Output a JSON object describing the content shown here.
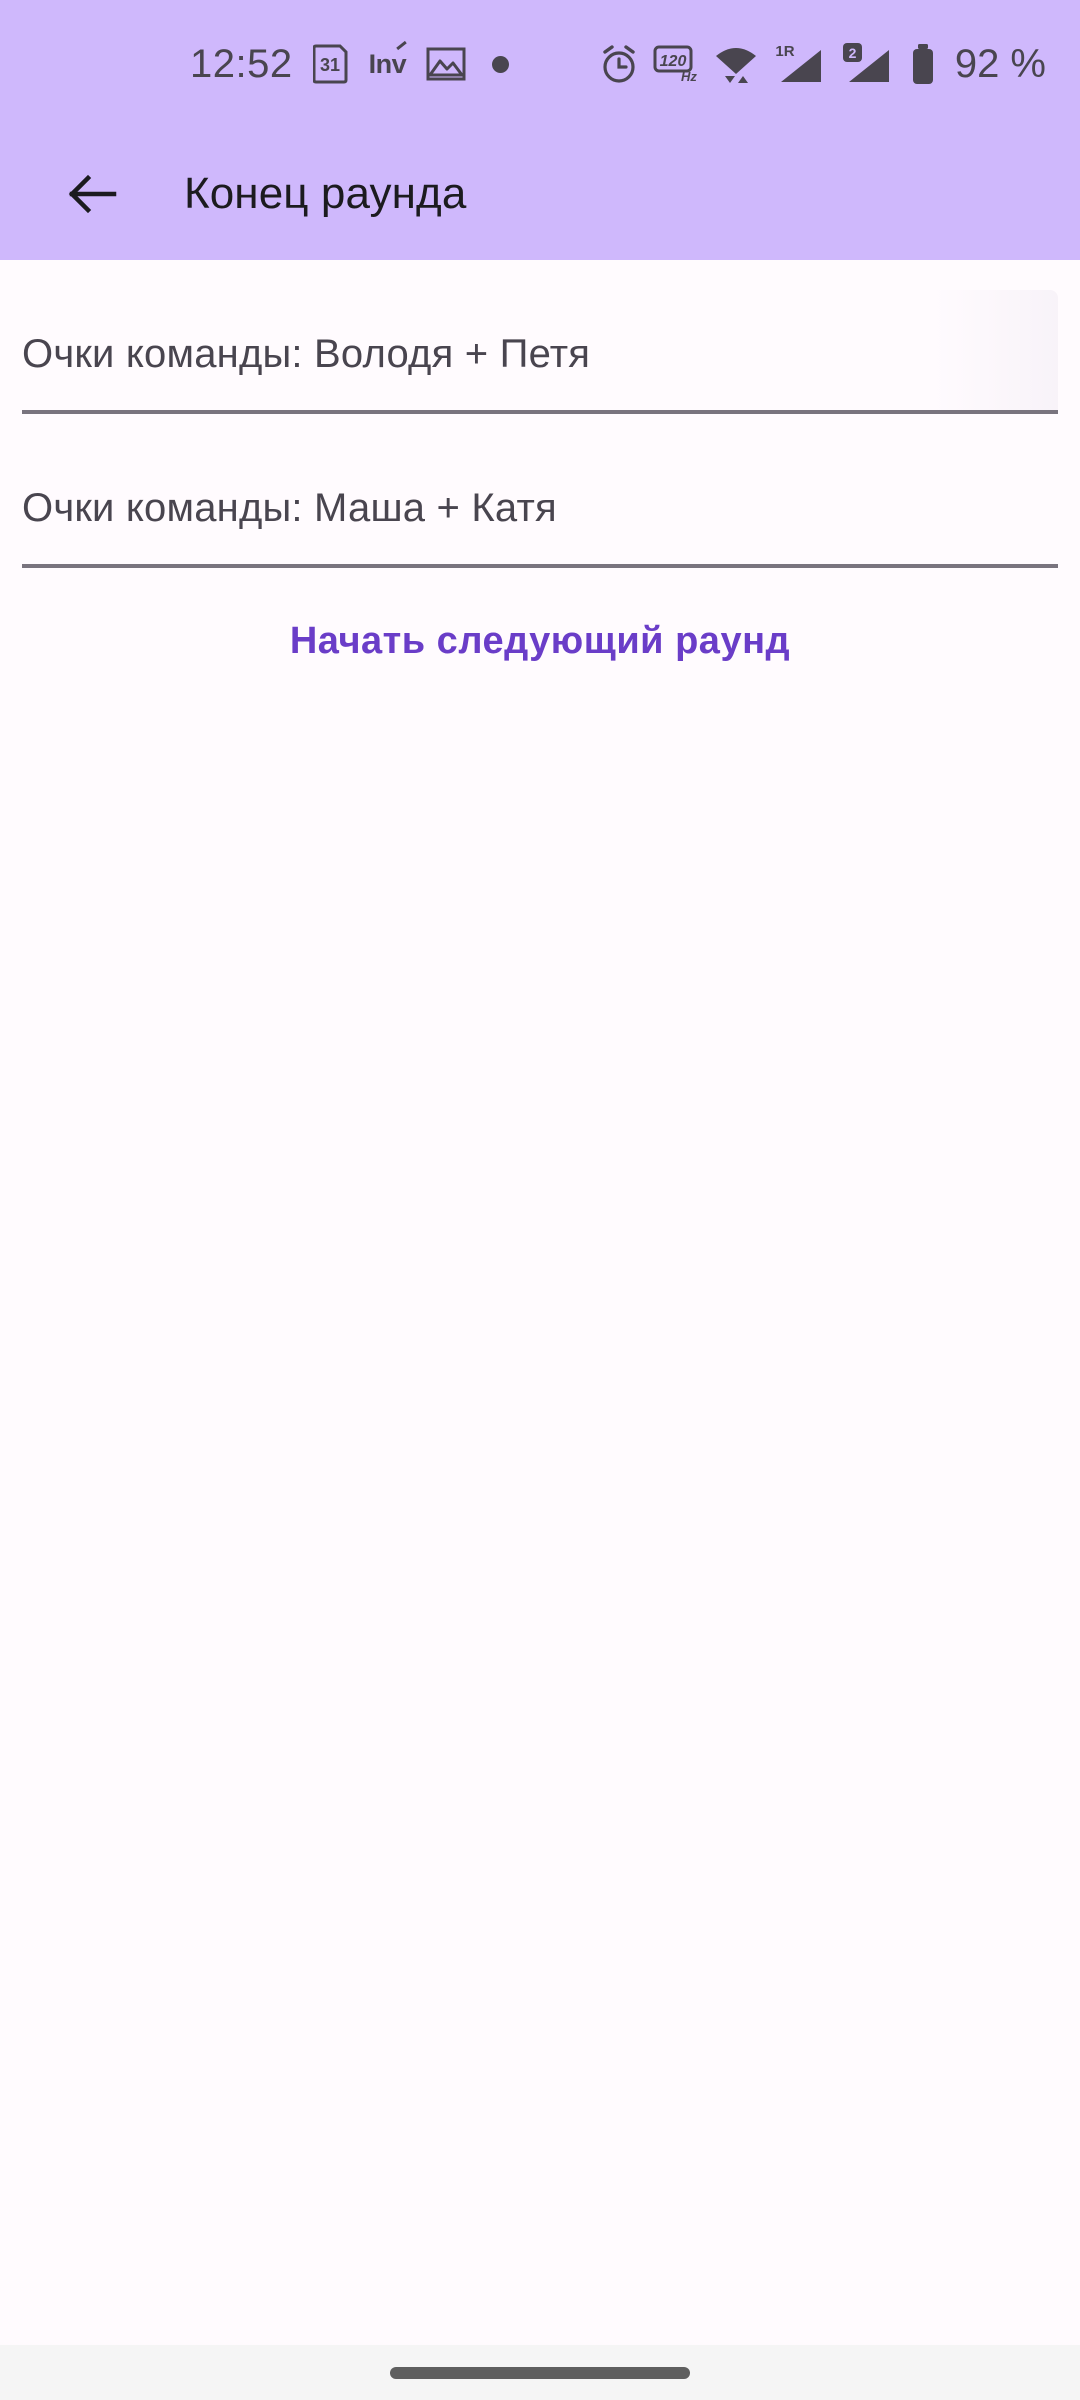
{
  "status_bar": {
    "time": "12:52",
    "calendar_day": "31",
    "app_badge_text": "Inv",
    "battery_percent": "92 %",
    "refresh_rate": "120",
    "refresh_rate_unit": "Hz",
    "sim1_label": "1R",
    "sim2_label": "2",
    "icons": [
      "calendar-31-icon",
      "invision-app-icon",
      "image-icon",
      "notification-dot-icon",
      "alarm-clock-icon",
      "refresh-rate-120hz-icon",
      "wifi-icon",
      "cellular-signal-1-icon",
      "cellular-signal-2-icon",
      "battery-icon"
    ],
    "background_color": "#CFB8FC",
    "foreground_color": "#49454F"
  },
  "app_bar": {
    "title": "Конец раунда",
    "back_icon": "arrow-left-icon",
    "background_color": "#CFB8FC",
    "title_color": "#1C1B1F"
  },
  "main": {
    "fields": [
      {
        "label": "Очки команды: Володя + Петя",
        "value": "",
        "placeholder": ""
      },
      {
        "label": "Очки команды: Маша + Катя",
        "value": "",
        "placeholder": ""
      }
    ],
    "primary_action": {
      "label": "Начать следующий раунд",
      "color": "#6A3DC8"
    },
    "background_color": "#FFFBFE",
    "underline_color": "#79747E",
    "label_color": "#49454F"
  },
  "nav_bar": {
    "handle": "gesture-home-pill",
    "background_color": "#F5F5F5",
    "pill_color": "#5F5F5F"
  }
}
